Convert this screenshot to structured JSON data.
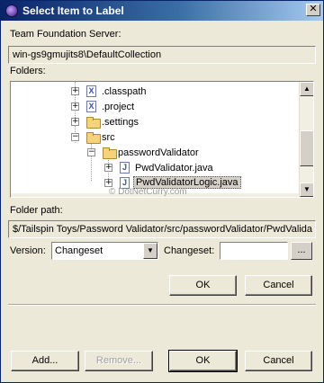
{
  "window": {
    "title": "Select Item to Label",
    "close_glyph": "✕"
  },
  "server": {
    "label": "Team Foundation Server:",
    "value": "win-gs9gmujits8\\DefaultCollection"
  },
  "folders": {
    "label": "Folders:",
    "items": [
      {
        "name": ".classpath",
        "icon": "x-file-icon"
      },
      {
        "name": ".project",
        "icon": "x-file-icon"
      },
      {
        "name": ".settings",
        "icon": "folder-icon"
      },
      {
        "name": "src",
        "icon": "folder-open-icon"
      },
      {
        "name": "passwordValidator",
        "icon": "folder-open-icon"
      },
      {
        "name": "PwdValidator.java",
        "icon": "java-file-icon"
      },
      {
        "name": "PwdValidatorLogic.java",
        "icon": "java-file-icon",
        "selected": true
      }
    ]
  },
  "watermark": "© DotNetCurry.com",
  "folder_path": {
    "label": "Folder path:",
    "value": "$/Tailspin Toys/Password Validator/src/passwordValidator/PwdValida"
  },
  "version": {
    "label": "Version:",
    "selected": "Changeset",
    "changeset_label": "Changeset:",
    "changeset_value": "",
    "browse_label": "..."
  },
  "buttons": {
    "ok_top": "OK",
    "cancel_top": "Cancel",
    "add": "Add...",
    "remove": "Remove...",
    "ok_bottom": "OK",
    "cancel_bottom": "Cancel"
  }
}
